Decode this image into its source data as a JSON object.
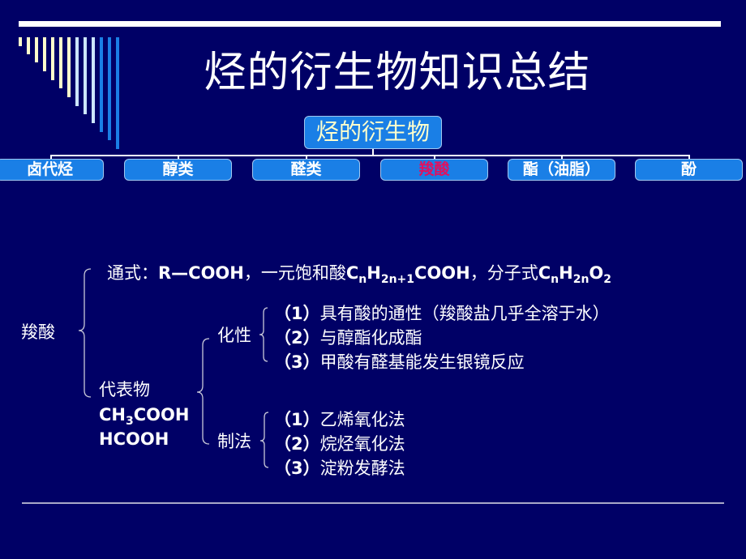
{
  "slide": {
    "title": "烃的衍生物知识总结",
    "colors": {
      "background": "#000066",
      "box_fill": "#1a7fe6",
      "root_text": "#ffffcc",
      "highlight_text": "#e0115f",
      "deco_bars_light": "#ffffcc",
      "deco_bars_pale_blue": "#cce6ff",
      "deco_bars_blue": "#1a7fe6"
    },
    "hierarchy": {
      "root": "烃的衍生物",
      "categories": [
        {
          "label": "卤代烃",
          "highlighted": false
        },
        {
          "label": "醇类",
          "highlighted": false
        },
        {
          "label": "醛类",
          "highlighted": false
        },
        {
          "label": "羧酸",
          "highlighted": true
        },
        {
          "label": "酯（油脂）",
          "highlighted": false
        },
        {
          "label": "酚",
          "highlighted": false
        }
      ]
    },
    "outline": {
      "topic": "羧酸",
      "general_formula": {
        "prefix": "通式：",
        "formula": "R—COOH",
        "sep1": "，一元饱和酸",
        "sat_C": "C",
        "sat_n": "n",
        "sat_H": "H",
        "sat_sub": "2n+1",
        "sat_tail": "COOH",
        "sep2": "，分子式",
        "mol_C": "C",
        "mol_n": "n",
        "mol_H": "H",
        "mol_sub_H": "2n",
        "mol_O": "O",
        "mol_sub_O": "2"
      },
      "representatives": {
        "label": "代表物",
        "compound1_a": "CH",
        "compound1_sub": "3",
        "compound1_b": "COOH",
        "compound2": "HCOOH"
      },
      "chemical_properties": {
        "label": "化性",
        "items": [
          {
            "num": "（1）",
            "text": "具有酸的通性（羧酸盐几乎全溶于水）"
          },
          {
            "num": "（2）",
            "text": "与醇酯化成酯"
          },
          {
            "num": "（3）",
            "text": "甲酸有醛基能发生银镜反应"
          }
        ]
      },
      "preparation": {
        "label": "制法",
        "items": [
          {
            "num": "（1）",
            "text": "乙烯氧化法"
          },
          {
            "num": "（2）",
            "text": "烷烃氧化法"
          },
          {
            "num": "（3）",
            "text": "淀粉发酵法"
          }
        ]
      }
    }
  }
}
